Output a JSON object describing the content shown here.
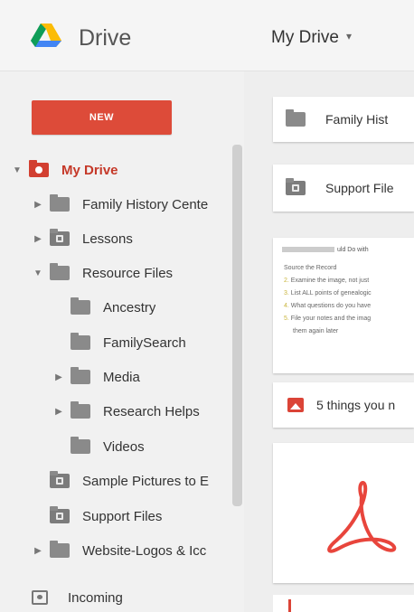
{
  "header": {
    "app_name": "Drive",
    "location": "My Drive",
    "location_caret": "▾"
  },
  "sidebar": {
    "new_label": "NEW",
    "tree": [
      {
        "label": "My Drive",
        "arrow": "▼"
      },
      {
        "label": "Family History Cente",
        "arrow": "▶"
      },
      {
        "label": "Lessons",
        "arrow": "▶"
      },
      {
        "label": "Resource Files",
        "arrow": "▼"
      },
      {
        "label": "Ancestry",
        "arrow": ""
      },
      {
        "label": "FamilySearch",
        "arrow": ""
      },
      {
        "label": "Media",
        "arrow": "▶"
      },
      {
        "label": "Research Helps",
        "arrow": "▶"
      },
      {
        "label": "Videos",
        "arrow": ""
      },
      {
        "label": "Sample Pictures to E",
        "arrow": ""
      },
      {
        "label": "Support Files",
        "arrow": ""
      },
      {
        "label": "Website-Logos & Icc",
        "arrow": "▶"
      },
      {
        "label": "Incoming",
        "arrow": ""
      }
    ]
  },
  "main": {
    "cards": [
      {
        "label": "Family Hist"
      },
      {
        "label": "Support File"
      }
    ],
    "doc_preview": {
      "heading": "uld Do with",
      "lines": [
        {
          "num": "",
          "text": "Source the Record"
        },
        {
          "num": "2.",
          "text": "Examine the image, not just"
        },
        {
          "num": "3.",
          "text": "List ALL points of genealogic"
        },
        {
          "num": "4.",
          "text": "What questions do you have"
        },
        {
          "num": "5.",
          "text": "File your notes and the imag"
        },
        {
          "num": "",
          "text": "them again later"
        }
      ]
    },
    "image_caption": "5 things you n"
  },
  "colors": {
    "accent_red": "#dd4b39",
    "sidebar_bg": "#f1f1f1",
    "pdf_red": "#e8453c"
  }
}
